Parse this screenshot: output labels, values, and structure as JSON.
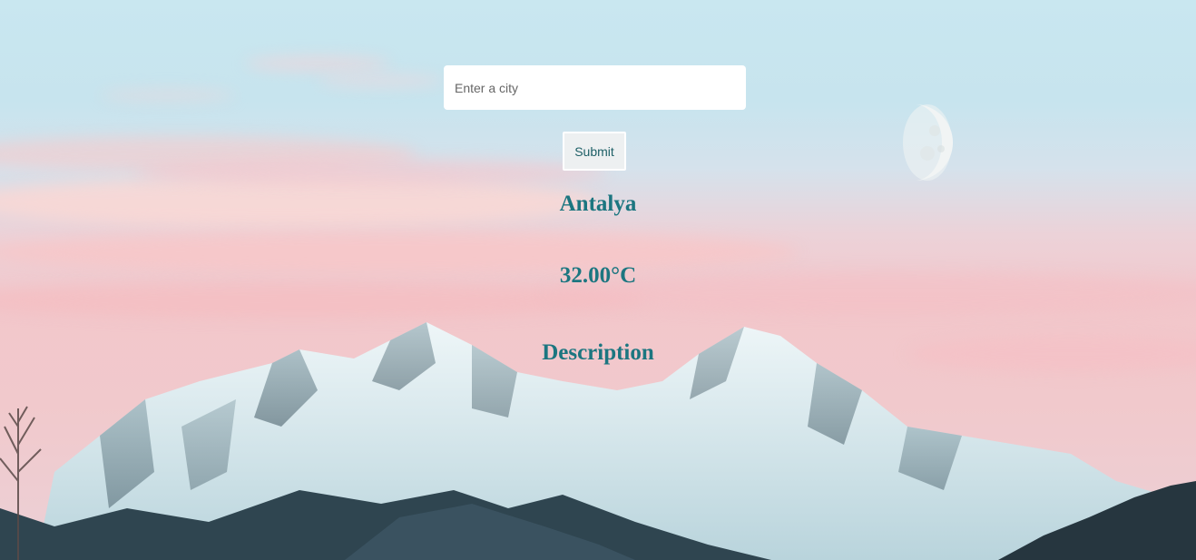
{
  "search": {
    "placeholder": "Enter a city",
    "value": ""
  },
  "submit_label": "Submit",
  "weather": {
    "city": "Antalya",
    "temperature": "32.00°C",
    "description": "Description"
  },
  "colors": {
    "text_accent": "#1c7680",
    "sky_top": "#c9e7f0",
    "sky_pink": "#f2c7cb"
  },
  "icons": {
    "background": "mountain-landscape",
    "moon": "moon-icon"
  }
}
